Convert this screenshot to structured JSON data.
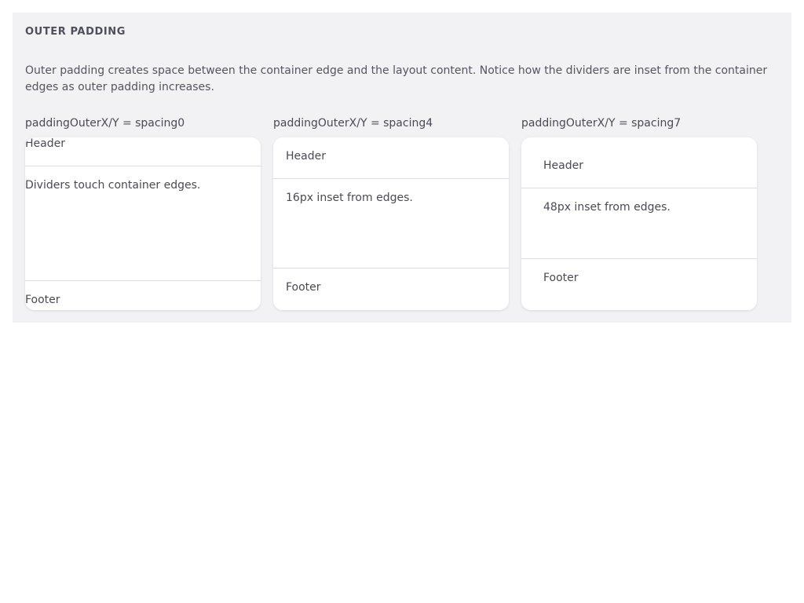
{
  "section": {
    "title": "OUTER PADDING",
    "description": "Outer padding creates space between the container edge and the layout content. Notice how the dividers are inset from the container edges as outer padding increases."
  },
  "examples": [
    {
      "label": "paddingOuterX/Y = spacing0",
      "header": "Header",
      "body": "Dividers touch container edges.",
      "footer": "Footer"
    },
    {
      "label": "paddingOuterX/Y = spacing4",
      "header": "Header",
      "body": "16px inset from edges.",
      "footer": "Footer"
    },
    {
      "label": "paddingOuterX/Y = spacing7",
      "header": "Header",
      "body": "48px inset from edges.",
      "footer": "Footer"
    }
  ]
}
